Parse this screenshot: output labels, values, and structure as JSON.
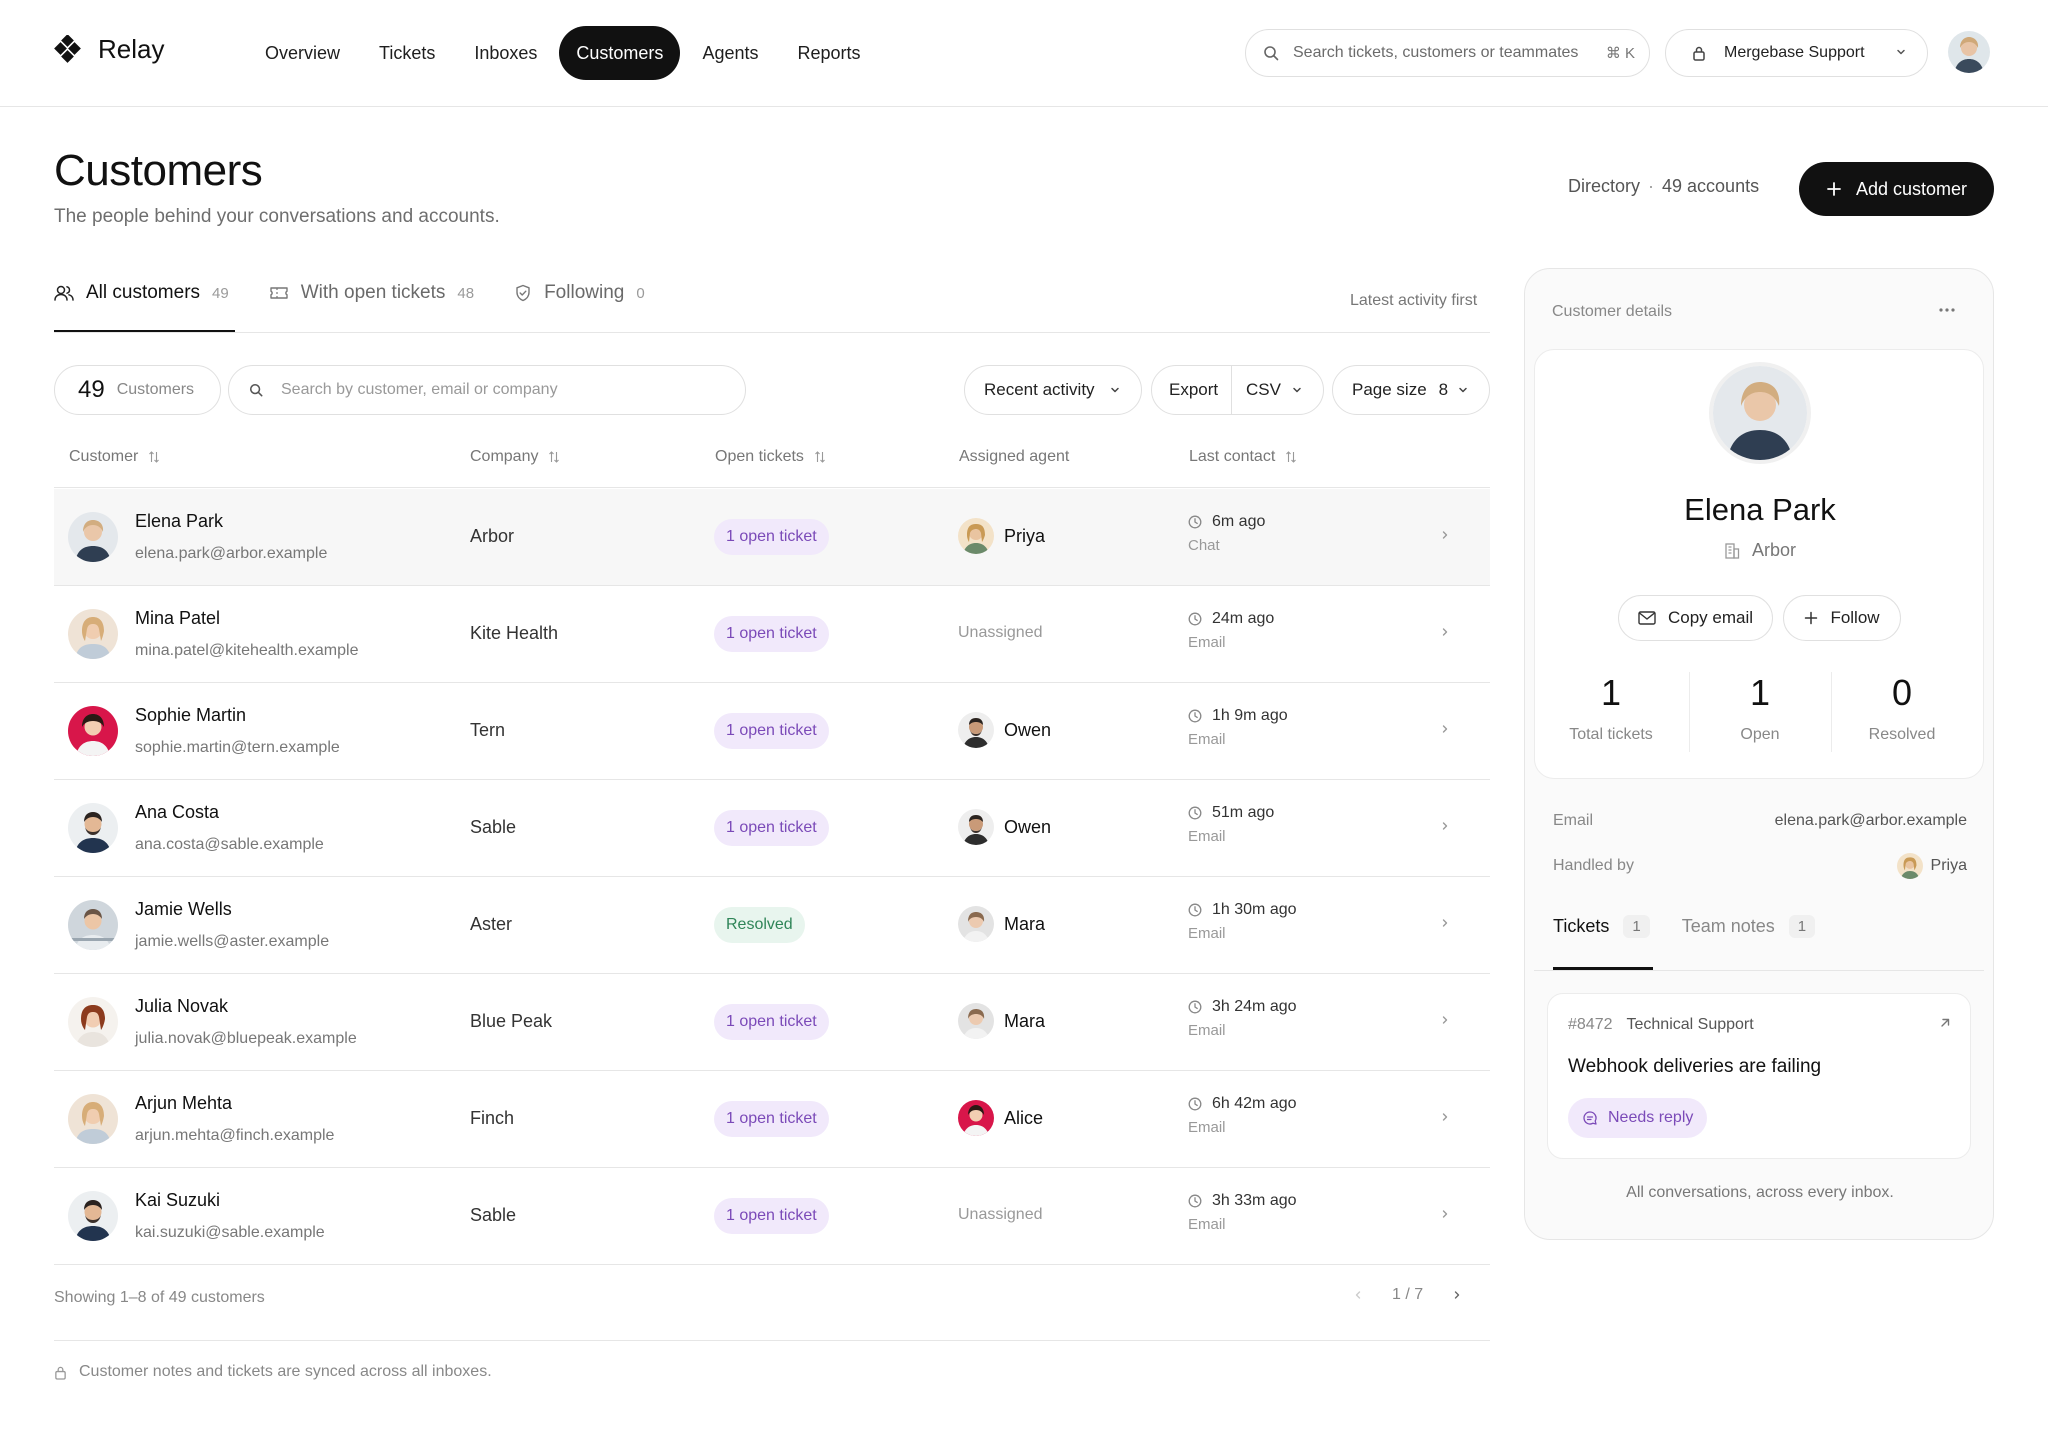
{
  "app": {
    "name": "Relay",
    "nav": [
      "Overview",
      "Tickets",
      "Inboxes",
      "Customers",
      "Agents",
      "Reports"
    ],
    "active_nav": "Customers",
    "search_placeholder": "Search tickets, customers or teammates",
    "search_shortcut": "⌘ K",
    "workspace": "Mergebase Support"
  },
  "page": {
    "title": "Customers",
    "subtitle": "The people behind your conversations and accounts.",
    "directory_label": "Directory",
    "directory_count": "49 accounts",
    "add_button": "Add customer"
  },
  "tabs": [
    {
      "label": "All customers",
      "count": "49",
      "icon": "users-icon"
    },
    {
      "label": "With open tickets",
      "count": "48",
      "icon": "ticket-icon"
    },
    {
      "label": "Following",
      "count": "0",
      "icon": "shield-icon"
    }
  ],
  "sort_hint": "Latest activity first",
  "filters": {
    "count": "49",
    "count_label": "Customers",
    "search_placeholder": "Search by customer, email or company",
    "sort": "Recent activity",
    "export": "Export",
    "export_format": "CSV",
    "page_size_label": "Page size",
    "page_size": "8"
  },
  "table": {
    "columns": [
      "Customer",
      "Company",
      "Open tickets",
      "Assigned agent",
      "Last contact"
    ],
    "rows": [
      {
        "name": "Elena Park",
        "email": "elena.park@arbor.example",
        "company": "Arbor",
        "status": "1 open ticket",
        "status_kind": "open",
        "agent": "Priya",
        "time": "6m ago",
        "channel": "Chat"
      },
      {
        "name": "Mina Patel",
        "email": "mina.patel@kitehealth.example",
        "company": "Kite Health",
        "status": "1 open ticket",
        "status_kind": "open",
        "agent": "Unassigned",
        "time": "24m ago",
        "channel": "Email"
      },
      {
        "name": "Sophie Martin",
        "email": "sophie.martin@tern.example",
        "company": "Tern",
        "status": "1 open ticket",
        "status_kind": "open",
        "agent": "Owen",
        "time": "1h 9m ago",
        "channel": "Email"
      },
      {
        "name": "Ana Costa",
        "email": "ana.costa@sable.example",
        "company": "Sable",
        "status": "1 open ticket",
        "status_kind": "open",
        "agent": "Owen",
        "time": "51m ago",
        "channel": "Email"
      },
      {
        "name": "Jamie Wells",
        "email": "jamie.wells@aster.example",
        "company": "Aster",
        "status": "Resolved",
        "status_kind": "resolved",
        "agent": "Mara",
        "time": "1h 30m ago",
        "channel": "Email"
      },
      {
        "name": "Julia Novak",
        "email": "julia.novak@bluepeak.example",
        "company": "Blue Peak",
        "status": "1 open ticket",
        "status_kind": "open",
        "agent": "Mara",
        "time": "3h 24m ago",
        "channel": "Email"
      },
      {
        "name": "Arjun Mehta",
        "email": "arjun.mehta@finch.example",
        "company": "Finch",
        "status": "1 open ticket",
        "status_kind": "open",
        "agent": "Alice",
        "time": "6h 42m ago",
        "channel": "Email"
      },
      {
        "name": "Kai Suzuki",
        "email": "kai.suzuki@sable.example",
        "company": "Sable",
        "status": "1 open ticket",
        "status_kind": "open",
        "agent": "Unassigned",
        "time": "3h 33m ago",
        "channel": "Email"
      }
    ]
  },
  "pagination": {
    "showing": "Showing 1–8 of 49 customers",
    "page": "1 / 7"
  },
  "footnote": "Customer notes and tickets are synced across all inboxes.",
  "panel": {
    "title": "Customer details",
    "name": "Elena Park",
    "company": "Arbor",
    "copy_email": "Copy email",
    "follow": "Follow",
    "stats": [
      {
        "value": "1",
        "label": "Total tickets"
      },
      {
        "value": "1",
        "label": "Open"
      },
      {
        "value": "0",
        "label": "Resolved"
      }
    ],
    "email_label": "Email",
    "email": "elena.park@arbor.example",
    "handled_label": "Handled by",
    "handled_by": "Priya",
    "tabs": [
      {
        "label": "Tickets",
        "count": "1"
      },
      {
        "label": "Team notes",
        "count": "1"
      }
    ],
    "ticket": {
      "id": "#8472",
      "team": "Technical Support",
      "subject": "Webhook deliveries are failing",
      "status": "Needs reply"
    },
    "footer": "All conversations, across every inbox."
  },
  "colors": {
    "accent": "#111111",
    "open_badge_bg": "#f1e9fb",
    "open_badge_text": "#7b4ab8",
    "resolved_bg": "#e8f5ee",
    "resolved_text": "#2f8558"
  }
}
